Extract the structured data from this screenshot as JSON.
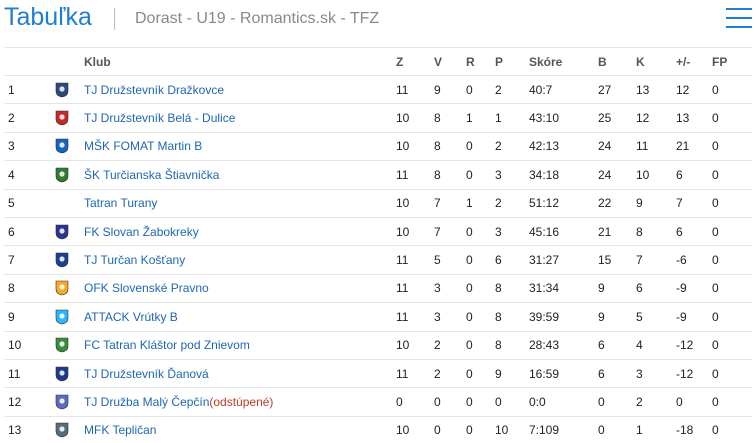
{
  "header": {
    "title": "Tabuľka",
    "subtitle": "Dorast - U19 - Romantics.sk - TFZ"
  },
  "columns": {
    "club": "Klub",
    "z": "Z",
    "v": "V",
    "r": "R",
    "p": "P",
    "score": "Skóre",
    "b": "B",
    "k": "K",
    "pm": "+/-",
    "fp": "FP"
  },
  "rows": [
    {
      "pos": "1",
      "club": "TJ Družstevník Dražkovce",
      "note": "",
      "z": "11",
      "v": "9",
      "r": "0",
      "p": "2",
      "score": "40:7",
      "b": "27",
      "k": "13",
      "pm": "12",
      "fp": "0",
      "logo": "ball-crest-icon",
      "color": "#2b4a7a"
    },
    {
      "pos": "2",
      "club": "TJ Družstevník Belá - Dulice",
      "note": "",
      "z": "10",
      "v": "8",
      "r": "1",
      "p": "1",
      "score": "43:10",
      "b": "25",
      "k": "12",
      "pm": "13",
      "fp": "0",
      "logo": "red-white-crest-icon",
      "color": "#c62828"
    },
    {
      "pos": "3",
      "club": "MŠK FOMAT Martin B",
      "note": "",
      "z": "10",
      "v": "8",
      "r": "0",
      "p": "2",
      "score": "42:13",
      "b": "24",
      "k": "11",
      "pm": "21",
      "fp": "0",
      "logo": "blue-flag-crest-icon",
      "color": "#1565c0"
    },
    {
      "pos": "4",
      "club": "ŠK Turčianska Štiavnička",
      "note": "",
      "z": "11",
      "v": "8",
      "r": "0",
      "p": "3",
      "score": "34:18",
      "b": "24",
      "k": "10",
      "pm": "6",
      "fp": "0",
      "logo": "green-crest-icon",
      "color": "#2e7d32"
    },
    {
      "pos": "5",
      "club": "Tatran Turany",
      "note": "",
      "z": "10",
      "v": "7",
      "r": "1",
      "p": "2",
      "score": "51:12",
      "b": "22",
      "k": "9",
      "pm": "7",
      "fp": "0",
      "logo": "",
      "color": ""
    },
    {
      "pos": "6",
      "club": "FK Slovan Žabokreky",
      "note": "",
      "z": "10",
      "v": "7",
      "r": "0",
      "p": "3",
      "score": "45:16",
      "b": "21",
      "k": "8",
      "pm": "6",
      "fp": "0",
      "logo": "navy-round-crest-icon",
      "color": "#283593"
    },
    {
      "pos": "7",
      "club": "TJ Turčan Košťany",
      "note": "",
      "z": "11",
      "v": "5",
      "r": "0",
      "p": "6",
      "score": "31:27",
      "b": "15",
      "k": "7",
      "pm": "-6",
      "fp": "0",
      "logo": "blue-shield-icon",
      "color": "#1a3f8f"
    },
    {
      "pos": "8",
      "club": "OFK Slovenské Pravno",
      "note": "",
      "z": "11",
      "v": "3",
      "r": "0",
      "p": "8",
      "score": "31:34",
      "b": "9",
      "k": "6",
      "pm": "-9",
      "fp": "0",
      "logo": "yellow-crest-icon",
      "color": "#f9a825"
    },
    {
      "pos": "9",
      "club": "ATTACK Vrútky B",
      "note": "",
      "z": "11",
      "v": "3",
      "r": "0",
      "p": "8",
      "score": "39:59",
      "b": "9",
      "k": "5",
      "pm": "-9",
      "fp": "0",
      "logo": "cyan-shield-icon",
      "color": "#29b6f6"
    },
    {
      "pos": "10",
      "club": "FC Tatran Kláštor pod Znievom",
      "note": "",
      "z": "10",
      "v": "2",
      "r": "0",
      "p": "8",
      "score": "28:43",
      "b": "6",
      "k": "4",
      "pm": "-12",
      "fp": "0",
      "logo": "green-tower-crest-icon",
      "color": "#388e3c"
    },
    {
      "pos": "11",
      "club": "TJ Družstevník Ďanová",
      "note": "",
      "z": "11",
      "v": "2",
      "r": "0",
      "p": "9",
      "score": "16:59",
      "b": "6",
      "k": "3",
      "pm": "-12",
      "fp": "0",
      "logo": "blue-white-shield-icon",
      "color": "#1e3a8a"
    },
    {
      "pos": "12",
      "club": "TJ Družba Malý Čepčín",
      "note": "(odstúpené)",
      "z": "0",
      "v": "0",
      "r": "0",
      "p": "0",
      "score": "0:0",
      "b": "0",
      "k": "2",
      "pm": "0",
      "fp": "0",
      "logo": "small-pennant-icon",
      "color": "#5c6bc0"
    },
    {
      "pos": "13",
      "club": "MFK Tepličan",
      "note": "",
      "z": "10",
      "v": "0",
      "r": "0",
      "p": "10",
      "score": "7:109",
      "b": "0",
      "k": "1",
      "pm": "-18",
      "fp": "0",
      "logo": "wolf-crest-icon",
      "color": "#546e7a"
    }
  ]
}
